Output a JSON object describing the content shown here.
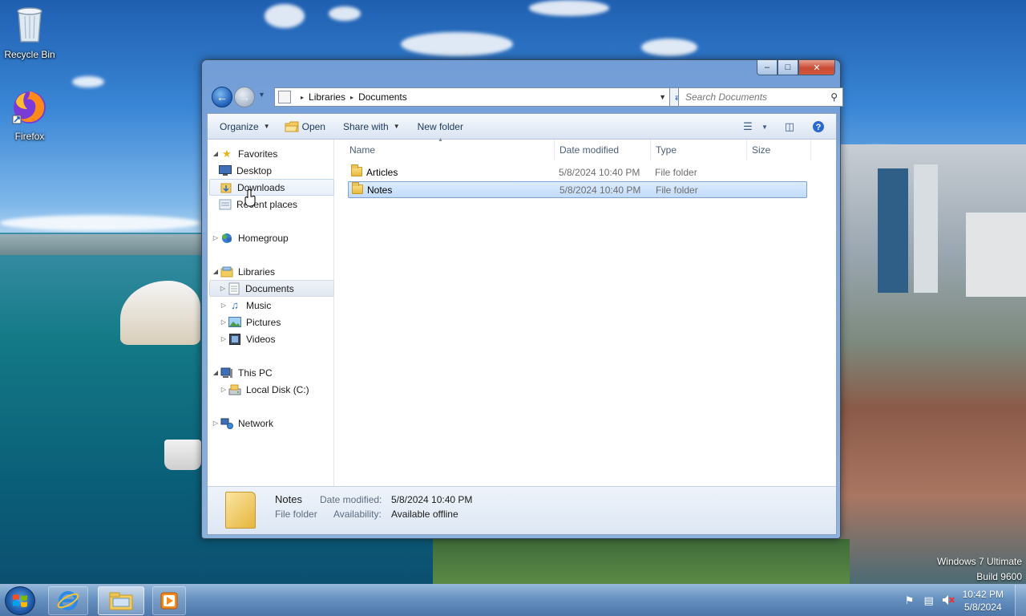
{
  "desktop": {
    "icons": [
      {
        "label": "Recycle Bin",
        "icon": "recycle-bin-icon"
      },
      {
        "label": "Firefox",
        "icon": "firefox-icon"
      }
    ],
    "watermark": {
      "line1": "Windows 7 Ultimate",
      "line2": "Build 9600"
    }
  },
  "window": {
    "controls": {
      "minimize": "–",
      "maximize": "□",
      "close": "✕"
    },
    "address": {
      "root_glyph": "▸",
      "crumbs": [
        "Libraries",
        "Documents"
      ]
    },
    "search": {
      "placeholder": "Search Documents"
    },
    "toolbar": {
      "organize": "Organize",
      "open": "Open",
      "share_with": "Share with",
      "new_folder": "New folder"
    },
    "nav": {
      "favorites": "Favorites",
      "desktop": "Desktop",
      "downloads": "Downloads",
      "recent_places": "Recent places",
      "homegroup": "Homegroup",
      "libraries": "Libraries",
      "documents": "Documents",
      "music": "Music",
      "pictures": "Pictures",
      "videos": "Videos",
      "this_pc": "This PC",
      "local_disk": "Local Disk (C:)",
      "network": "Network"
    },
    "columns": {
      "name": "Name",
      "date_modified": "Date modified",
      "type": "Type",
      "size": "Size"
    },
    "files": [
      {
        "name": "Articles",
        "date": "5/8/2024 10:40 PM",
        "type": "File folder",
        "selected": false
      },
      {
        "name": "Notes",
        "date": "5/8/2024 10:40 PM",
        "type": "File folder",
        "selected": true
      }
    ],
    "details": {
      "name": "Notes",
      "kind": "File folder",
      "date_label": "Date modified:",
      "date_value": "5/8/2024 10:40 PM",
      "avail_label": "Availability:",
      "avail_value": "Available offline"
    }
  },
  "taskbar": {
    "clock_time": "10:42 PM",
    "clock_date": "5/8/2024",
    "pinned": [
      "internet-explorer-icon",
      "file-explorer-icon",
      "media-player-icon"
    ]
  },
  "colors": {
    "selection": "#c1dbfc",
    "selection_border": "#7da2ce",
    "toolbar_text": "#1e3958"
  }
}
